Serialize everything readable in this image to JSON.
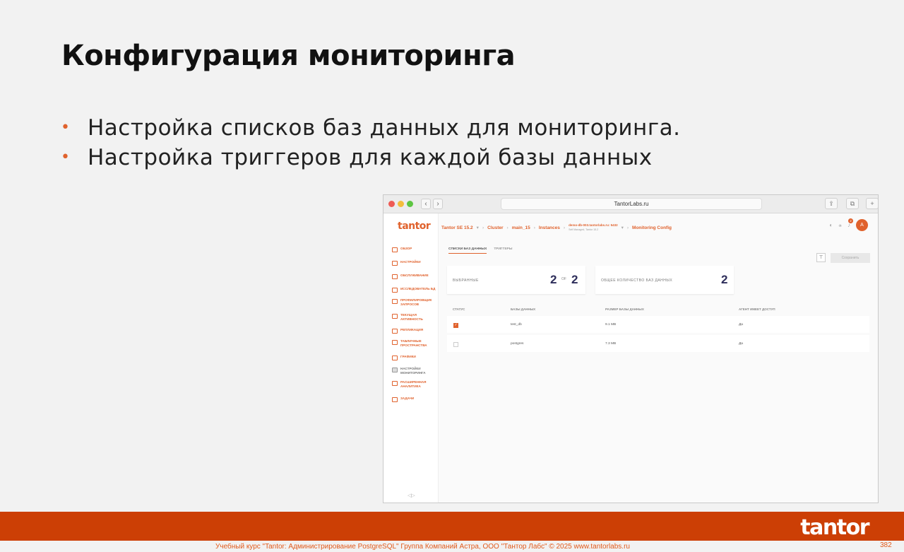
{
  "slide": {
    "title": "Конфигурация мониторинга",
    "bullets": [
      "Настройка списков баз данных для мониторинга.",
      "Настройка триггеров для каждой базы данных"
    ]
  },
  "browser": {
    "url": "TantorLabs.ru",
    "back": "‹",
    "forward": "›",
    "share": "⇪",
    "tabs": "⧉",
    "new_tab": "+"
  },
  "app": {
    "logo": "tantor",
    "breadcrumbs": {
      "product": "Tantor SE 15.2",
      "cluster": "Cluster",
      "cluster_name": "main_15",
      "instances": "Instances",
      "host": "demo-db-003.tantorlabs.ru: 5432",
      "host_sub": "Self Managed, Tantor 15.2",
      "page": "Monitoring Config"
    },
    "notification_count": "2",
    "avatar_letter": "A",
    "sidebar": [
      "Обзор",
      "Настройки",
      "Обслуживание",
      "Исследователь БД",
      "Профилировщик запросов",
      "Текущая активность",
      "Репликация",
      "Табличные пространства",
      "Графики",
      "Настройки мониторинга",
      "Расширенная аналитика",
      "Задачи"
    ],
    "tabs": [
      "Списки баз данных",
      "Триггеры"
    ],
    "save_label": "Сохранить",
    "cards": {
      "selected_label": "Выбранные",
      "selected_value": "2",
      "of_label": "of",
      "total_selected": "2",
      "total_label": "Общее количество баз данных",
      "total_value": "2"
    },
    "table": {
      "columns": [
        "Статус",
        "Базы данных",
        "Размер базы данных",
        "Агент имеет доступ"
      ],
      "rows": [
        {
          "name": "test_db",
          "size": "9.1 MB",
          "access": "Да",
          "checked": true
        },
        {
          "name": "postgres",
          "size": "7.3 MB",
          "access": "Да",
          "checked": false
        }
      ]
    }
  },
  "footer": {
    "logo": "tantor",
    "note": "Учебный курс \"Tantor: Администрирование PostgreSQL\" Группа Компаний Астра, ООО \"Тантор Лабс\" © 2025  www.tantorlabs.ru",
    "page": "382"
  }
}
